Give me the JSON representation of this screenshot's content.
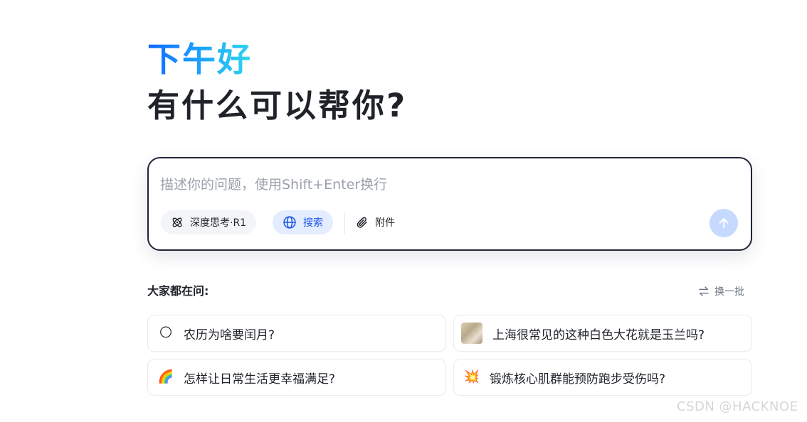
{
  "greeting": "下午好",
  "subtitle": "有什么可以帮你?",
  "composer": {
    "placeholder": "描述你的问题，使用Shift+Enter换行",
    "value": "",
    "think_label": "深度思考·R1",
    "search_label": "搜索",
    "attach_label": "附件"
  },
  "suggestions": {
    "title": "大家都在问:",
    "refresh_label": "换一批",
    "items": [
      {
        "icon": "full-moon-emoji-icon",
        "glyph": "🌕",
        "text": "农历为啥要闰月?"
      },
      {
        "icon": "magnolia-photo-thumbnail",
        "glyph": "",
        "text": "上海很常见的这种白色大花就是玉兰吗?"
      },
      {
        "icon": "rainbow-emoji-icon",
        "glyph": "🌈",
        "text": "怎样让日常生活更幸福满足?"
      },
      {
        "icon": "sparkle-emoji-icon",
        "glyph": "💥",
        "text": "锻炼核心肌群能预防跑步受伤吗?"
      }
    ]
  },
  "watermark": "CSDN @HACKNOE",
  "colors": {
    "accent": "#1a55e6",
    "send_button": "#c6d9ff",
    "composer_border": "#1f2538"
  }
}
